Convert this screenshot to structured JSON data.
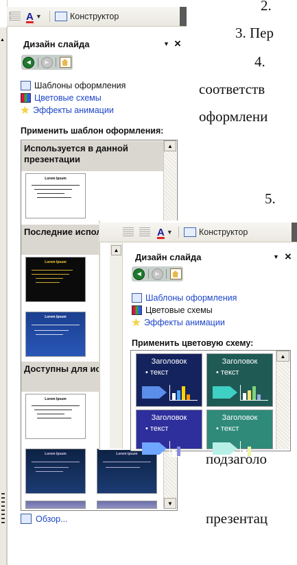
{
  "document": {
    "lines": [
      "2.",
      "3. Пер",
      "4.",
      "соответств",
      "оформлени",
      "5.",
      "подзаголо",
      "презентац"
    ]
  },
  "toolbar": {
    "font_color_letter": "A",
    "designer_label": "Конструктор"
  },
  "back_pane": {
    "title": "Дизайн слайда",
    "links": [
      "Шаблоны оформления",
      "Цветовые схемы",
      "Эффекты анимации"
    ],
    "section_label": "Применить шаблон оформления:",
    "groups": [
      "Используется в данной презентации",
      "Последние использованные",
      "Доступны для использования"
    ],
    "thumb_title": "Lorem Ipsum",
    "browse_label": "Обзор..."
  },
  "front_pane": {
    "title": "Дизайн слайда",
    "links": [
      "Шаблоны оформления",
      "Цветовые схемы",
      "Эффекты анимации"
    ],
    "section_label": "Применить цветовую схему:",
    "scheme_heading": "Заголовок",
    "scheme_text": "• текст",
    "schemes": [
      {
        "bg": "#14235e",
        "arrow": "#5b8dea",
        "bars": [
          "#ffffff",
          "#4aa3ff",
          "#ffd400",
          "#ff9900"
        ]
      },
      {
        "bg": "#1f5a55",
        "arrow": "#3fd0c4",
        "bars": [
          "#ffffff",
          "#ffe070",
          "#7fd17f",
          "#9ad"
        ]
      },
      {
        "bg": "#2e2f9c",
        "arrow": "#6fa6ff",
        "bars": [
          "#ffffff",
          "#88d"
        ]
      },
      {
        "bg": "#2f8a7a",
        "arrow": "#b8f0e8",
        "bars": [
          "#ffffff",
          "#eaf5a5"
        ]
      }
    ]
  },
  "icons": {
    "close": "×",
    "dropdown": "▼",
    "back": "◄",
    "forward": "►",
    "scroll_up": "▲",
    "scroll_down": "▼"
  }
}
